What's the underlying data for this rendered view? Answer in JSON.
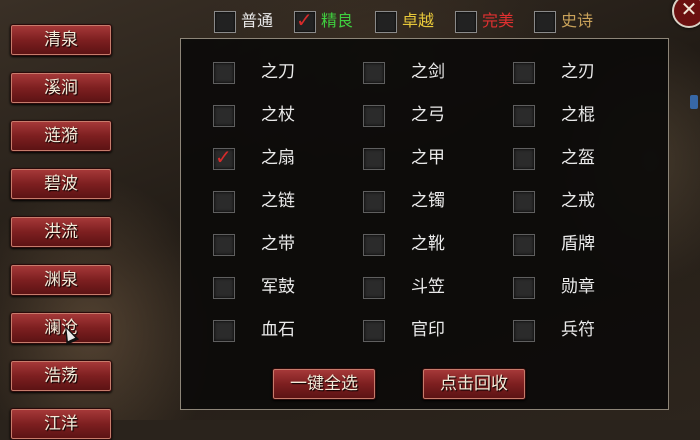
{
  "close_glyph": "✕",
  "categories": [
    "清泉",
    "溪涧",
    "涟漪",
    "碧波",
    "洪流",
    "渊泉",
    "澜沧",
    "浩荡",
    "江洋"
  ],
  "quality_filters": [
    {
      "label": "普通",
      "checked": false,
      "color": "#e8e8e8"
    },
    {
      "label": "精良",
      "checked": true,
      "color": "#3fcf3f"
    },
    {
      "label": "卓越",
      "checked": false,
      "color": "#e8c83a"
    },
    {
      "label": "完美",
      "checked": false,
      "color": "#e03030"
    },
    {
      "label": "史诗",
      "checked": false,
      "color": "#c9a25a"
    }
  ],
  "items": [
    {
      "label": "之刀",
      "checked": false
    },
    {
      "label": "之剑",
      "checked": false
    },
    {
      "label": "之刃",
      "checked": false
    },
    {
      "label": "之杖",
      "checked": false
    },
    {
      "label": "之弓",
      "checked": false
    },
    {
      "label": "之棍",
      "checked": false
    },
    {
      "label": "之扇",
      "checked": true
    },
    {
      "label": "之甲",
      "checked": false
    },
    {
      "label": "之盔",
      "checked": false
    },
    {
      "label": "之链",
      "checked": false
    },
    {
      "label": "之镯",
      "checked": false
    },
    {
      "label": "之戒",
      "checked": false
    },
    {
      "label": "之带",
      "checked": false
    },
    {
      "label": "之靴",
      "checked": false
    },
    {
      "label": "盾牌",
      "checked": false
    },
    {
      "label": "军鼓",
      "checked": false
    },
    {
      "label": "斗笠",
      "checked": false
    },
    {
      "label": "勋章",
      "checked": false
    },
    {
      "label": "血石",
      "checked": false
    },
    {
      "label": "官印",
      "checked": false
    },
    {
      "label": "兵符",
      "checked": false
    }
  ],
  "actions": {
    "select_all": "一键全选",
    "recycle": "点击回收"
  }
}
